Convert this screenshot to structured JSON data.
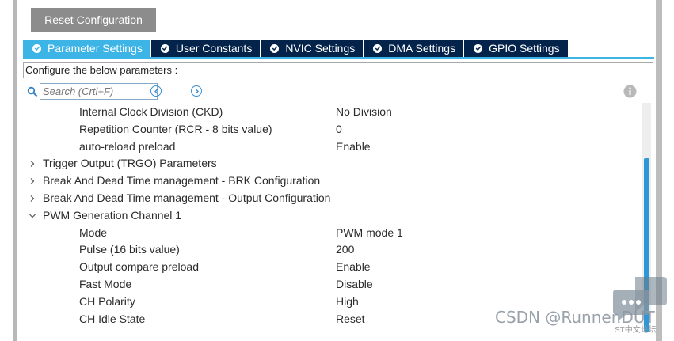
{
  "toolbar": {
    "reset_label": "Reset Configuration"
  },
  "tabs": [
    {
      "label": "Parameter Settings",
      "active": true
    },
    {
      "label": "User Constants",
      "active": false
    },
    {
      "label": "NVIC Settings",
      "active": false
    },
    {
      "label": "DMA Settings",
      "active": false
    },
    {
      "label": "GPIO Settings",
      "active": false
    }
  ],
  "config_prompt": "Configure the below parameters :",
  "search": {
    "placeholder": "Search (Crtl+F)"
  },
  "params": [
    {
      "type": "param",
      "name": "Internal Clock Division (CKD)",
      "value": "No Division"
    },
    {
      "type": "param",
      "name": "Repetition Counter (RCR - 8 bits value)",
      "value": "0"
    },
    {
      "type": "param",
      "name": "auto-reload preload",
      "value": "Enable"
    },
    {
      "type": "group",
      "name": "Trigger Output (TRGO) Parameters",
      "expanded": false
    },
    {
      "type": "group",
      "name": "Break And Dead Time management - BRK Configuration",
      "expanded": false
    },
    {
      "type": "group",
      "name": "Break And Dead Time management - Output Configuration",
      "expanded": false
    },
    {
      "type": "group",
      "name": "PWM Generation Channel 1",
      "expanded": true
    },
    {
      "type": "param",
      "name": "Mode",
      "value": "PWM mode 1"
    },
    {
      "type": "param",
      "name": "Pulse (16 bits value)",
      "value": "200"
    },
    {
      "type": "param",
      "name": "Output compare preload",
      "value": "Enable"
    },
    {
      "type": "param",
      "name": "Fast Mode",
      "value": "Disable"
    },
    {
      "type": "param",
      "name": "CH Polarity",
      "value": "High"
    },
    {
      "type": "param",
      "name": "CH Idle State",
      "value": "Reset"
    }
  ],
  "watermark": {
    "text": "CSDN @Runner.DUT",
    "logo_caption": "ST中文论坛"
  },
  "colors": {
    "accent": "#3cb4e6",
    "tab_inactive": "#03234b",
    "scroll_thumb": "#2d97d8"
  }
}
